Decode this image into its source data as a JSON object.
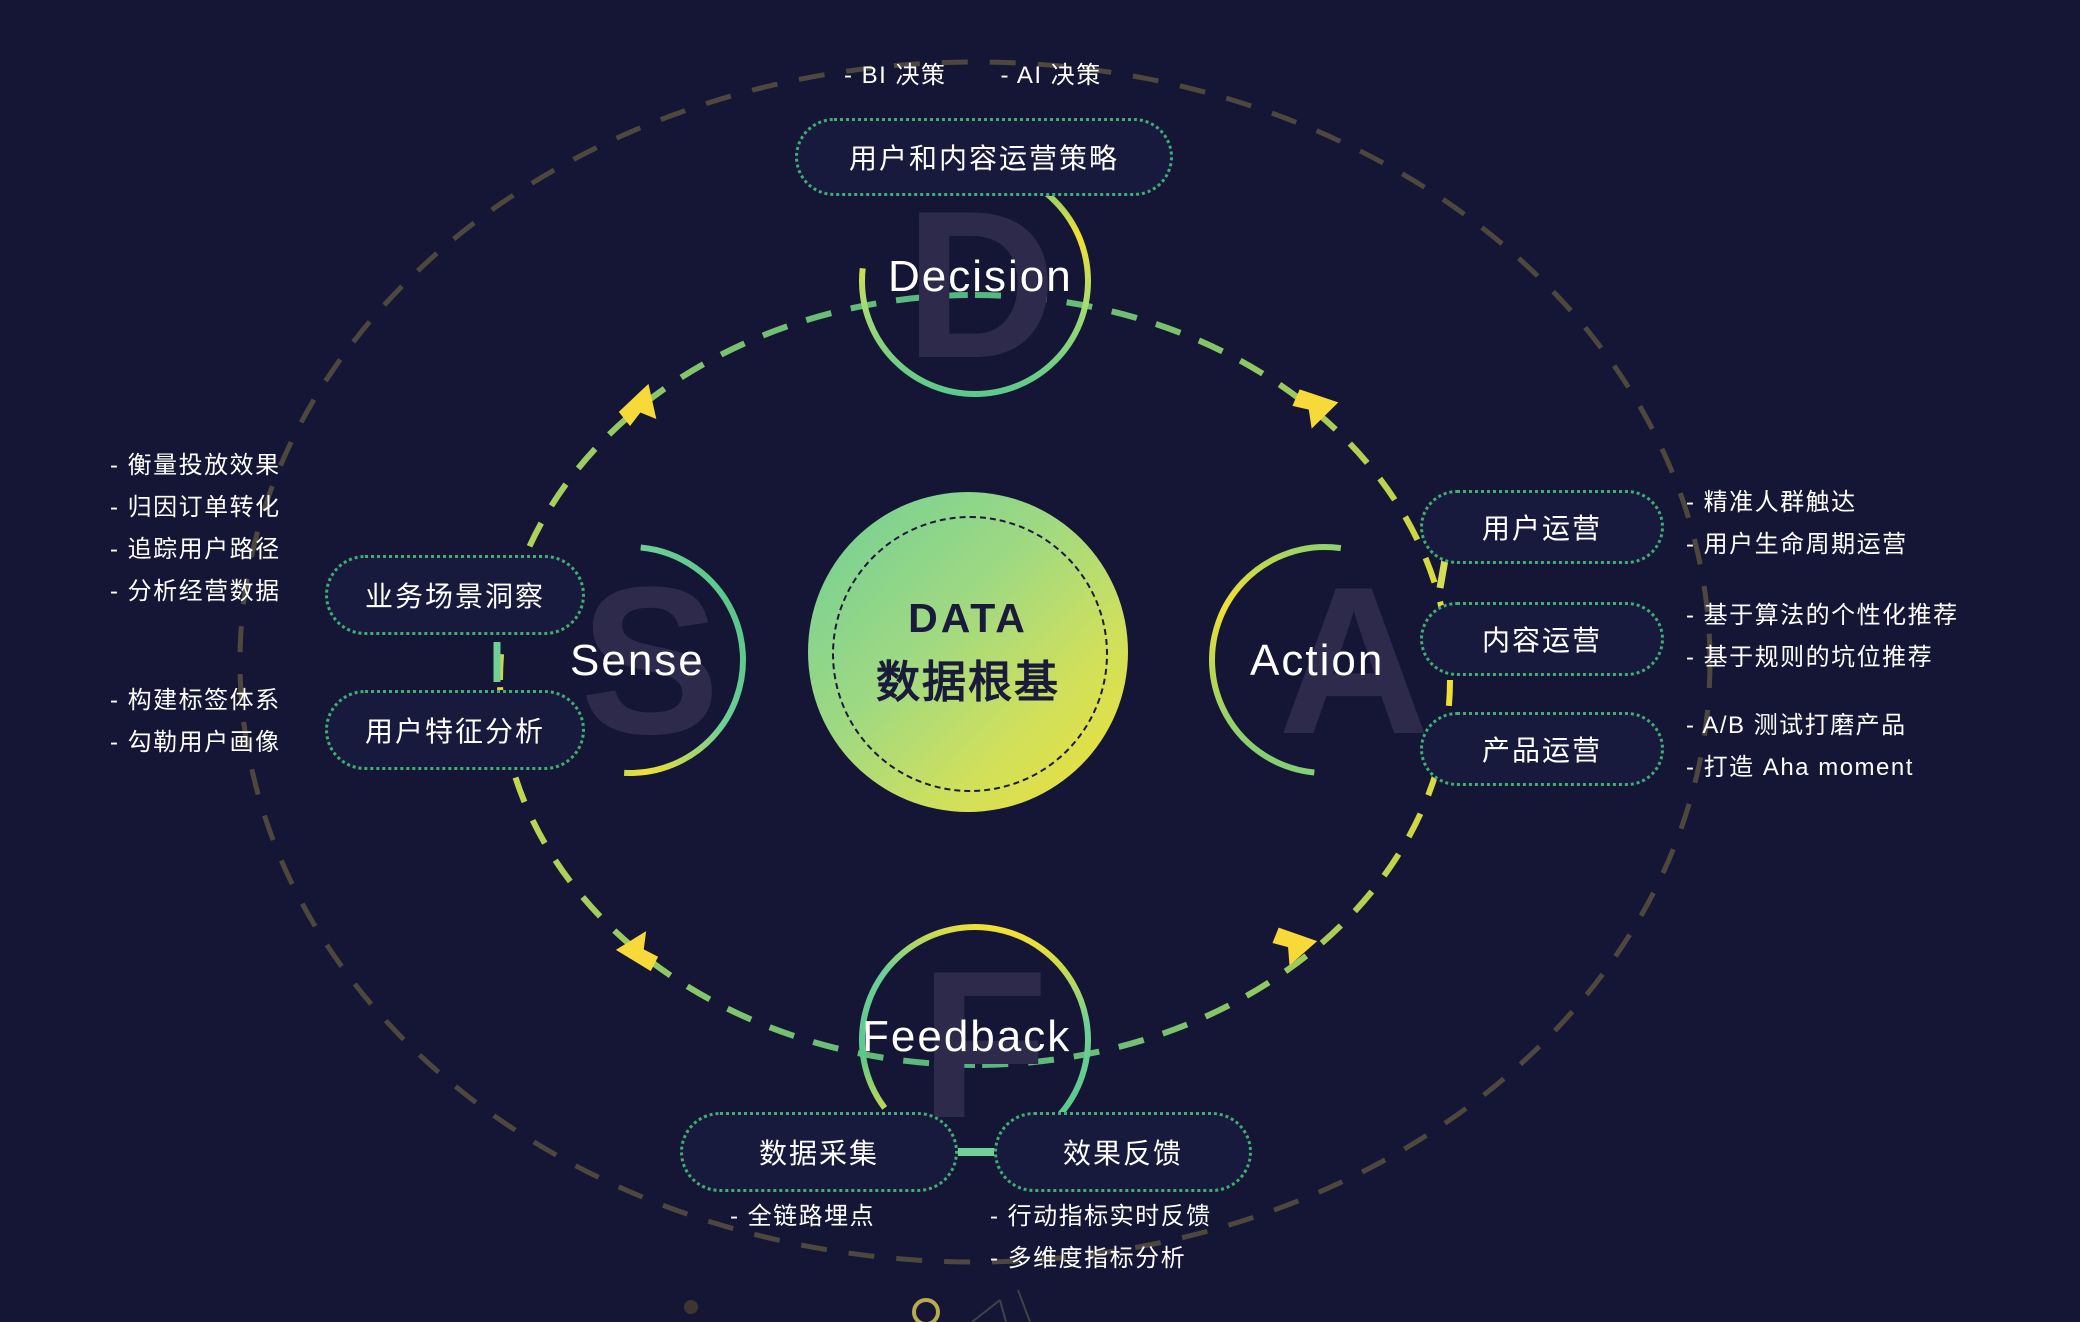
{
  "background": "#151635",
  "colors": {
    "bg": "#151635",
    "green": "#3fae73",
    "green_light": "#6fcf97",
    "yellow": "#f2e033",
    "ghost": "#2e2a4b",
    "outer_orbit": "#4a4a4a",
    "text": "#ffffff"
  },
  "core": {
    "title_en": "DATA",
    "title_cn": "数据根基"
  },
  "stages": {
    "decision": {
      "label": "Decision",
      "ghost": "D",
      "pill": "用户和内容运营策略",
      "notes": [
        "- BI 决策",
        "- AI 决策"
      ]
    },
    "sense": {
      "label": "Sense",
      "ghost": "S",
      "pills": [
        {
          "title": "业务场景洞察",
          "notes": [
            "- 衡量投放效果",
            "- 归因订单转化",
            "- 追踪用户路径",
            "- 分析经营数据"
          ]
        },
        {
          "title": "用户特征分析",
          "notes": [
            "- 构建标签体系",
            "- 勾勒用户画像"
          ]
        }
      ]
    },
    "action": {
      "label": "Action",
      "ghost": "A",
      "pills": [
        {
          "title": "用户运营",
          "notes": [
            "- 精准人群触达",
            "- 用户生命周期运营"
          ]
        },
        {
          "title": "内容运营",
          "notes": [
            "- 基于算法的个性化推荐",
            "- 基于规则的坑位推荐"
          ]
        },
        {
          "title": "产品运营",
          "notes": [
            "- A/B 测试打磨产品",
            "- 打造 Aha moment"
          ]
        }
      ]
    },
    "feedback": {
      "label": "Feedback",
      "ghost": "F",
      "pills": [
        {
          "title": "数据采集",
          "notes": [
            "- 全链路埋点"
          ]
        },
        {
          "title": "效果反馈",
          "notes": [
            "- 行动指标实时反馈",
            "- 多维度指标分析"
          ]
        }
      ]
    }
  }
}
